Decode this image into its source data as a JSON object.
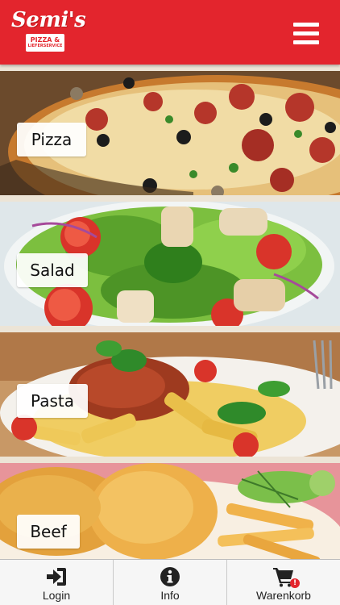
{
  "header": {
    "logo_text": "Semi's",
    "logo_sub1": "PIZZA &",
    "logo_sub2": "LIEFERSERVICE",
    "brand_color": "#e3252d",
    "menu_icon": "hamburger-menu-icon"
  },
  "categories": [
    {
      "label": "Pizza",
      "image": "pizza-photo"
    },
    {
      "label": "Salad",
      "image": "salad-photo"
    },
    {
      "label": "Pasta",
      "image": "pasta-photo"
    },
    {
      "label": "Beef",
      "image": "schnitzel-fries-photo"
    }
  ],
  "tabbar": {
    "items": [
      {
        "label": "Login",
        "icon": "login-arrow-icon"
      },
      {
        "label": "Info",
        "icon": "info-icon"
      },
      {
        "label": "Warenkorb",
        "icon": "cart-icon",
        "badge": "!"
      }
    ]
  }
}
